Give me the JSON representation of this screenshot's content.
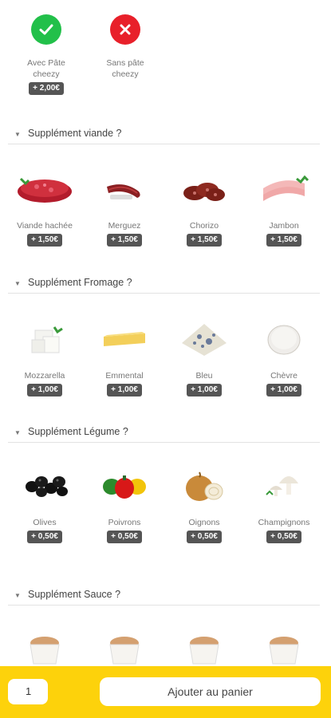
{
  "pate": [
    {
      "label_line1": "Avec Pâte",
      "label_line2": "cheezy",
      "price": "+ 2,00€",
      "icon": "check-icon",
      "color": "#22c04a"
    },
    {
      "label_line1": "Sans pâte",
      "label_line2": "cheezy",
      "price": "",
      "icon": "close-icon",
      "color": "#e8202a"
    }
  ],
  "sections": [
    {
      "title": "Supplément viande ?",
      "items": [
        {
          "name": "Viande hachée",
          "price": "+ 1,50€",
          "icon": "ground-beef-icon"
        },
        {
          "name": "Merguez",
          "price": "+ 1,50€",
          "icon": "merguez-icon"
        },
        {
          "name": "Chorizo",
          "price": "+ 1,50€",
          "icon": "chorizo-icon"
        },
        {
          "name": "Jambon",
          "price": "+ 1,50€",
          "icon": "ham-icon"
        }
      ]
    },
    {
      "title": "Supplément Fromage ?",
      "items": [
        {
          "name": "Mozzarella",
          "price": "+ 1,00€",
          "icon": "mozzarella-icon"
        },
        {
          "name": "Emmental",
          "price": "+ 1,00€",
          "icon": "emmental-icon"
        },
        {
          "name": "Bleu",
          "price": "+ 1,00€",
          "icon": "blue-cheese-icon"
        },
        {
          "name": "Chèvre",
          "price": "+ 1,00€",
          "icon": "goat-cheese-icon"
        }
      ]
    },
    {
      "title": "Supplément Légume ?",
      "items": [
        {
          "name": "Olives",
          "price": "+ 0,50€",
          "icon": "olives-icon"
        },
        {
          "name": "Poivrons",
          "price": "+ 0,50€",
          "icon": "peppers-icon"
        },
        {
          "name": "Oignons",
          "price": "+ 0,50€",
          "icon": "onions-icon"
        },
        {
          "name": "Champignons",
          "price": "+ 0,50€",
          "icon": "mushrooms-icon"
        }
      ]
    },
    {
      "title": "Supplément Sauce ?",
      "items": []
    }
  ],
  "bottom": {
    "quantity": "1",
    "add_label": "Ajouter au panier"
  },
  "colors": {
    "accent": "#fdd20b",
    "price_badge": "#555555"
  }
}
